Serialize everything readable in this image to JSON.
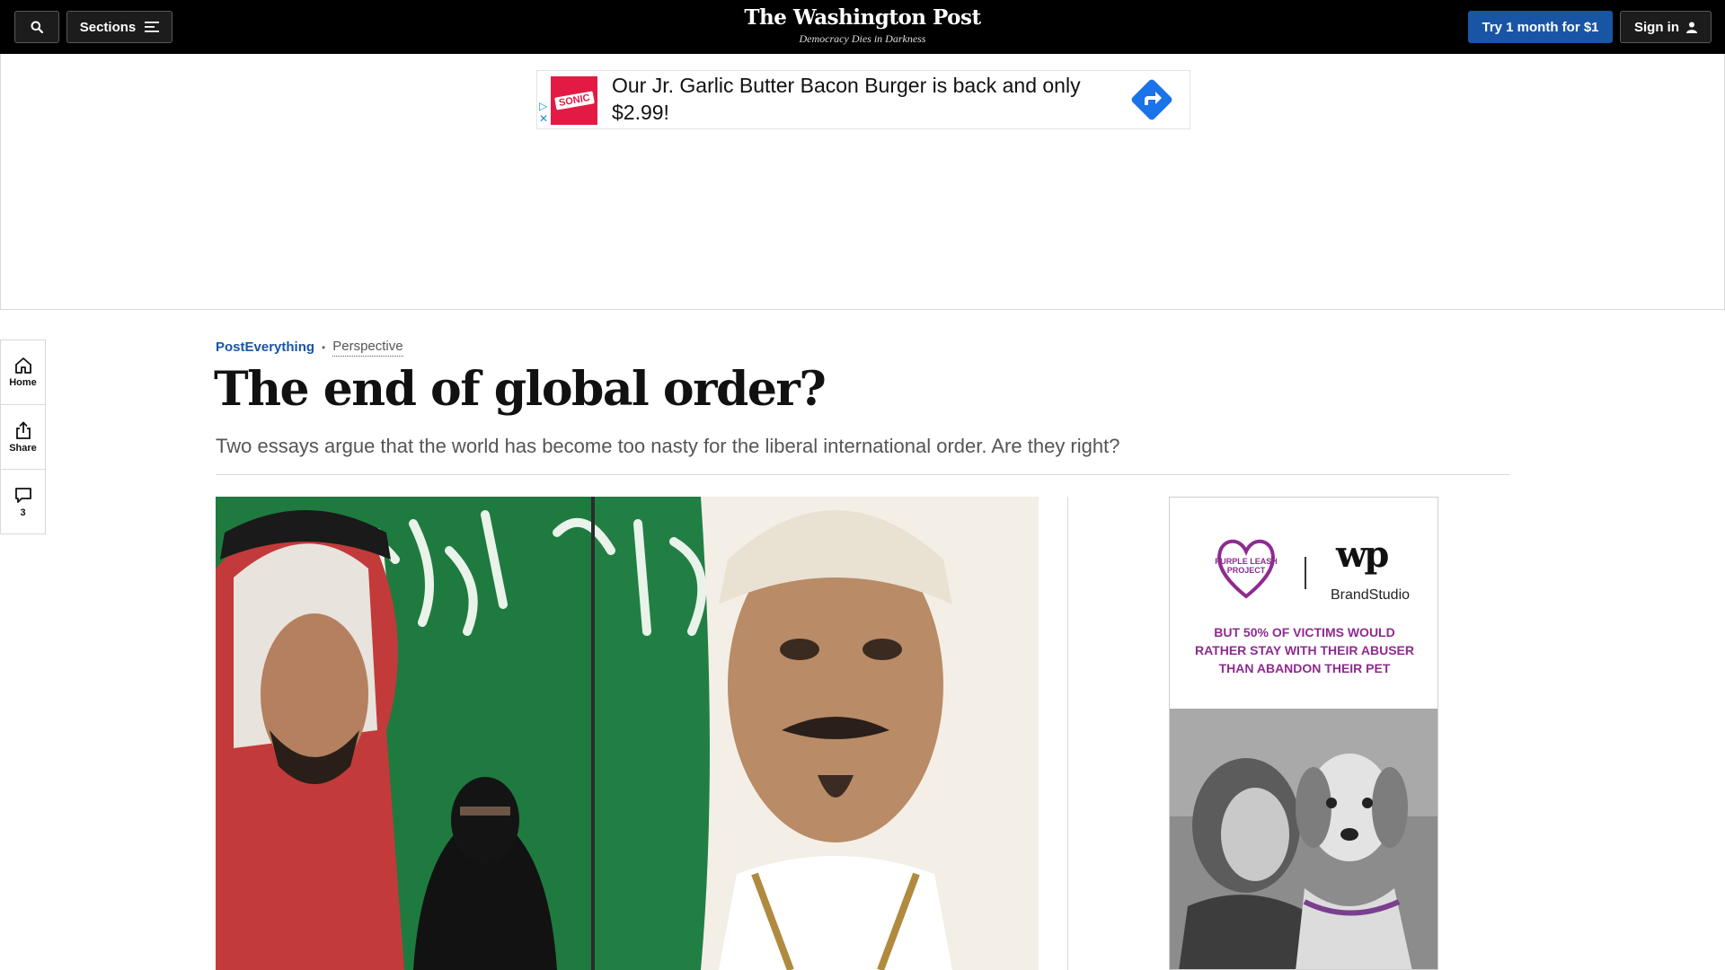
{
  "topbar": {
    "sections_label": "Sections",
    "masthead_title": "The Washington Post",
    "masthead_tagline": "Democracy Dies in Darkness",
    "subscribe_label": "Try 1 month for $1",
    "signin_label": "Sign in"
  },
  "banner_ad": {
    "brand": "SONIC",
    "text": "Our Jr. Garlic Butter Bacon Burger is back and only $2.99!"
  },
  "rail": {
    "home_label": "Home",
    "share_label": "Share",
    "comments_count": "3"
  },
  "article": {
    "section": "PostEverything",
    "label": "Perspective",
    "headline": "The end of global order?",
    "dek": "Two essays argue that the world has become too nasty for the liberal international order. Are they right?"
  },
  "side_ad": {
    "brand_logo_text": "PURPLE LEASH PROJECT",
    "brandstudio_label": "BrandStudio",
    "message": "BUT 50% OF VICTIMS WOULD RATHER STAY WITH THEIR ABUSER THAN ABANDON THEIR PET"
  },
  "colors": {
    "topbar_bg": "#000000",
    "accent_blue": "#1955a5",
    "sonic_red": "#e21a44",
    "ad_arrow_blue": "#1a73e8",
    "purple": "#8e2b8f"
  }
}
